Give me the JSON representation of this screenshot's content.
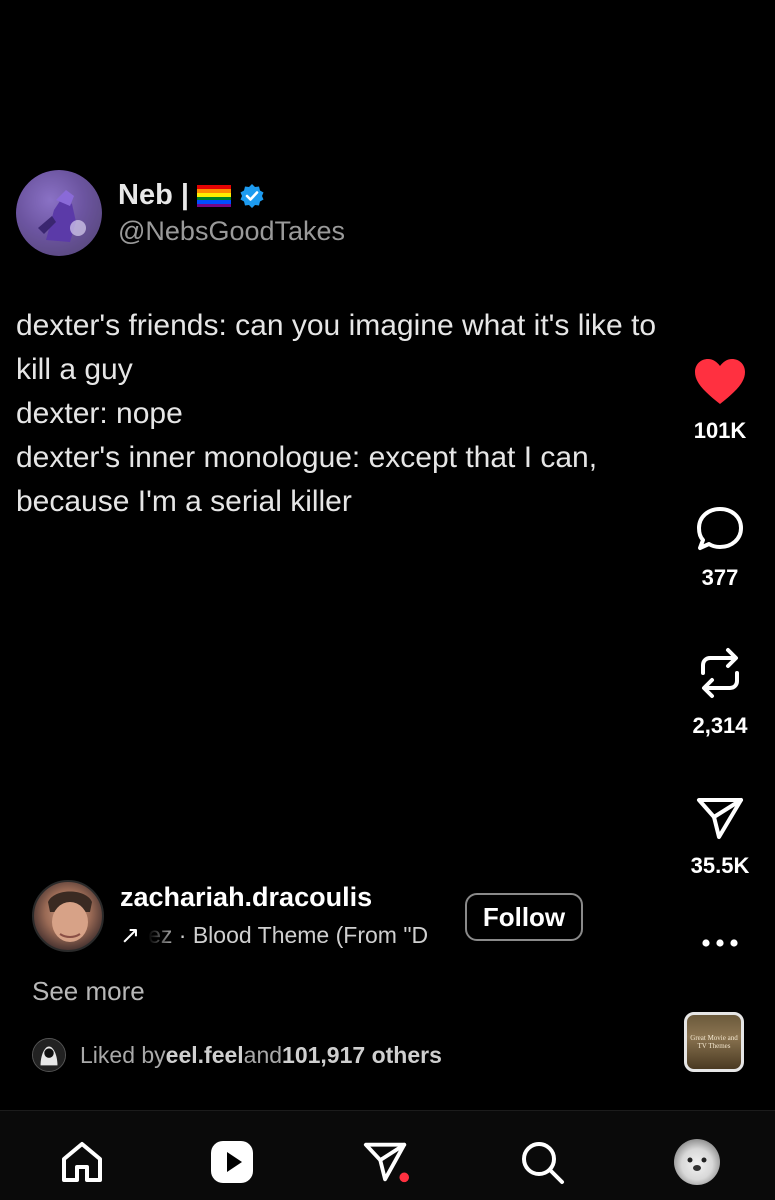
{
  "tweet": {
    "display_name": "Neb |",
    "handle": "@NebsGoodTakes",
    "body": "dexter's friends: can you imagine what it's like to\nkill a guy\ndexter: nope\ndexter's inner monologue: except that I can,\nbecause I'm a serial killer"
  },
  "actions": {
    "likes": "101K",
    "comments": "377",
    "reposts": "2,314",
    "shares": "35.5K",
    "more": "..."
  },
  "creator": {
    "username": "zachariah.dracoulis",
    "audio_arrow": "↗",
    "audio_text": "ez · Blood Theme (From \"D",
    "follow_label": "Follow"
  },
  "see_more": "See more",
  "liked": {
    "prefix": "Liked by ",
    "user": "eel.feel",
    "middle": " and ",
    "count": "101,917 others"
  },
  "audio_thumbnail": {
    "line1": "Great Movie and",
    "line2": "TV Themes"
  },
  "colors": {
    "background": "#000000",
    "like_red": "#ff3040",
    "verified_blue": "#1d9bf0",
    "notification_dot": "#ff3040"
  },
  "icons": {
    "nav": [
      "home-icon",
      "reels-icon",
      "direct-messages-icon",
      "search-icon",
      "profile-avatar"
    ]
  }
}
